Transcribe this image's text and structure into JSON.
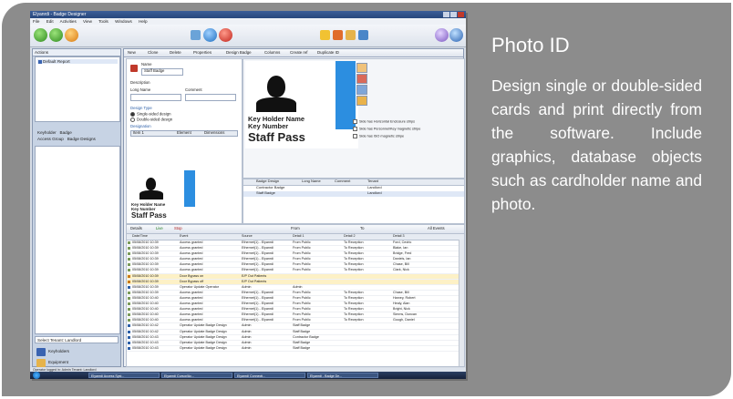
{
  "window": {
    "title": "Elyanrdi - Badge Designer",
    "menu": [
      "File",
      "Edit",
      "Activities",
      "View",
      "Tools",
      "Windows",
      "Help"
    ]
  },
  "left_pane": {
    "header": "Actions",
    "tree_item": "Default Report",
    "tabs": [
      "Keyholder",
      "Badge",
      "Access Group",
      "Badge Designs"
    ],
    "site_select": "Select Tenant: Landlord",
    "nav": [
      "Keyholders",
      "Equipment",
      "Systems"
    ]
  },
  "tabs": [
    "New",
    "Clone",
    "Delete",
    "Properties",
    "Design Badge",
    "Columns",
    "Create ref",
    "Duplicate ID"
  ],
  "form": {
    "name_label": "Name",
    "name_value": "Staff Badge",
    "description_label": "Description",
    "long_name_label": "Long Name",
    "comment_label": "Comment",
    "design_type_label": "Design Type",
    "single_sided": "Single-sided design",
    "double_sided": "Double-sided design",
    "designation_label": "Designation",
    "grid_cols": [
      "Item 1",
      "Element",
      "Dimensions"
    ]
  },
  "card_preview": {
    "line1": "Key Holder Name",
    "line2": "Key Number",
    "line3": "Staff Pass"
  },
  "card_options": [
    "Side has Horizontal Enclosure strips",
    "Side has Personnel/Key magnetic stripe",
    "Side has ISO magnetic stripe"
  ],
  "designs_table": {
    "columns": [
      "Badge Design",
      "Long Name",
      "Comment",
      "Tenant"
    ],
    "rows": [
      {
        "name": "Contractor Badge",
        "tenant": "Landlord"
      },
      {
        "name": "Staff Badge",
        "tenant": "Landlord"
      }
    ]
  },
  "events_bar": {
    "details": "Details",
    "live": "Live",
    "stop": "Stop",
    "from": "From",
    "to": "To",
    "all_events": "All Events"
  },
  "events": {
    "columns": [
      "Date/Time",
      "Event",
      "Source",
      "Detail 1",
      "Detail 2",
      "Detail 3"
    ],
    "rows": [
      [
        "05/08/2010 10:39",
        "Access granted",
        "Ethernet(1) - Elyanrdi",
        "From Public",
        "To Reception",
        "Ford, Cedric"
      ],
      [
        "05/08/2010 10:39",
        "Access granted",
        "Ethernet(1) - Elyanrdi",
        "From Public",
        "To Reception",
        "Blake, Ian"
      ],
      [
        "05/08/2010 10:39",
        "Access granted",
        "Ethernet(1) - Elyanrdi",
        "From Public",
        "To Reception",
        "Bridge, Fred"
      ],
      [
        "05/08/2010 10:39",
        "Access granted",
        "Ethernet(1) - Elyanrdi",
        "From Public",
        "To Reception",
        "Daniels, Ian"
      ],
      [
        "05/08/2010 10:39",
        "Access granted",
        "Ethernet(1) - Elyanrdi",
        "From Public",
        "To Reception",
        "Chase, Bill"
      ],
      [
        "05/08/2010 10:39",
        "Access granted",
        "Ethernet(1) - Elyanrdi",
        "From Public",
        "To Reception",
        "Clark, Nick"
      ],
      [
        "05/08/2010 10:39",
        "Door Bypass on",
        "E/P Out Patients",
        "",
        "",
        ""
      ],
      [
        "05/08/2010 10:39",
        "Door Bypass off",
        "E/P Out Patients",
        "",
        "",
        ""
      ],
      [
        "05/08/2010 10:39",
        "Operator Update Operator",
        "Admin",
        "Admin",
        "",
        ""
      ],
      [
        "05/08/2010 10:39",
        "Access granted",
        "Ethernet(1) - Elyanrdi",
        "From Public",
        "To Reception",
        "Chase, Bill"
      ],
      [
        "05/08/2010 10:40",
        "Access granted",
        "Ethernet(1) - Elyanrdi",
        "From Public",
        "To Reception",
        "Harvey, Robert"
      ],
      [
        "05/08/2010 10:40",
        "Access granted",
        "Ethernet(1) - Elyanrdi",
        "From Public",
        "To Reception",
        "Healy, Alan"
      ],
      [
        "05/08/2010 10:40",
        "Access granted",
        "Ethernet(1) - Elyanrdi",
        "From Public",
        "To Reception",
        "Bright, Nick"
      ],
      [
        "05/08/2010 10:40",
        "Access granted",
        "Ethernet(1) - Elyanrdi",
        "From Public",
        "To Reception",
        "Simms, Duncan"
      ],
      [
        "05/08/2010 10:40",
        "Access granted",
        "Ethernet(1) - Elyanrdi",
        "From Public",
        "To Reception",
        "Gough, Daniel"
      ],
      [
        "05/08/2010 10:42",
        "Operator Update Badge Design",
        "Admin",
        "Staff Badge",
        "",
        ""
      ],
      [
        "05/08/2010 10:42",
        "Operator Update Badge Design",
        "Admin",
        "Staff Badge",
        "",
        ""
      ],
      [
        "05/08/2010 10:43",
        "Operator Update Badge Design",
        "Admin",
        "Contractor Badge",
        "",
        ""
      ],
      [
        "05/08/2010 10:43",
        "Operator Update Badge Design",
        "Admin",
        "Staff Badge",
        "",
        ""
      ],
      [
        "05/08/2010 10:43",
        "Operator Update Badge Design",
        "Admin",
        "Staff Badge",
        "",
        ""
      ]
    ]
  },
  "status_bar": "Operator logged in: Admin  Tenant: Landlord",
  "taskbar": [
    "Elyanrdi Access Syst...",
    "Elyanrdi Cursor/Ac...",
    "Elyanrdi Connecti...",
    "Elyanrdi - Badge De..."
  ],
  "feature": {
    "heading": "Photo ID",
    "description": "Design single or double-sided cards and print directly from the software. Include graphics, database objects such as cardholder name and photo."
  },
  "colors": {
    "panel_bg": "#8c8c8c",
    "text": "#ffffff",
    "accent_blue": "#2c8ee0"
  }
}
